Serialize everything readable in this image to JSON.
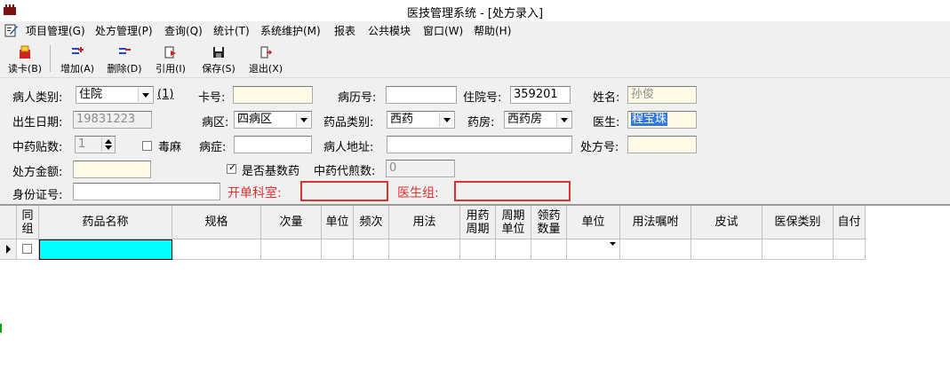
{
  "window": {
    "title": "医技管理系统 - [处方录入]"
  },
  "menu": [
    "项目管理(G)",
    "处方管理(P)",
    "查询(Q)",
    "统计(T)",
    "系统维护(M)",
    "报表",
    "公共模块",
    "窗口(W)",
    "帮助(H)"
  ],
  "toolbar": {
    "read_card": "读卡(B)",
    "add": "增加(A)",
    "delete": "删除(D)",
    "reference": "引用(I)",
    "save": "保存(S)",
    "exit": "退出(X)"
  },
  "form": {
    "patient_type": {
      "label": "病人类别:",
      "value": "住院",
      "extra": "(1)"
    },
    "card_no": {
      "label": "卡号:",
      "value": ""
    },
    "record_no": {
      "label": "病历号:",
      "value": ""
    },
    "inpatient_no": {
      "label": "住院号:",
      "value": "359201"
    },
    "name": {
      "label": "姓名:",
      "value": "孙俊"
    },
    "birth_date": {
      "label": "出生日期:",
      "value": "19831223"
    },
    "ward": {
      "label": "病区:",
      "value": "四病区"
    },
    "drug_type": {
      "label": "药品类别:",
      "value": "西药"
    },
    "pharmacy": {
      "label": "药房:",
      "value": "西药房"
    },
    "doctor": {
      "label": "医生:",
      "value": "程宝珠"
    },
    "tcm_doses": {
      "label": "中药贴数:",
      "value": "1"
    },
    "narcotic": {
      "label": "毒麻"
    },
    "diagnosis": {
      "label": "病症:",
      "value": ""
    },
    "address": {
      "label": "病人地址:",
      "value": ""
    },
    "rx_no": {
      "label": "处方号:",
      "value": ""
    },
    "rx_amount": {
      "label": "处方金额:",
      "value": ""
    },
    "essential_drug": {
      "label": "是否基数药",
      "checked": true
    },
    "tcm_decoction": {
      "label": "中药代煎数:",
      "value": "0"
    },
    "id_no": {
      "label": "身份证号:",
      "value": ""
    },
    "dept": {
      "label": "开单科室:",
      "value": ""
    },
    "doctor_group": {
      "label": "医生组:",
      "value": ""
    }
  },
  "grid": {
    "columns": [
      "同组",
      "药品名称",
      "规格",
      "次量",
      "单位",
      "频次",
      "用法",
      "用药周期",
      "周期单位",
      "领药数量",
      "单位",
      "用法嘱咐",
      "皮试",
      "医保类别",
      "自付"
    ]
  },
  "colors": {
    "accent_red": "#e03030",
    "selected_cell": "#00ffff",
    "highlight": "#3377dd"
  }
}
